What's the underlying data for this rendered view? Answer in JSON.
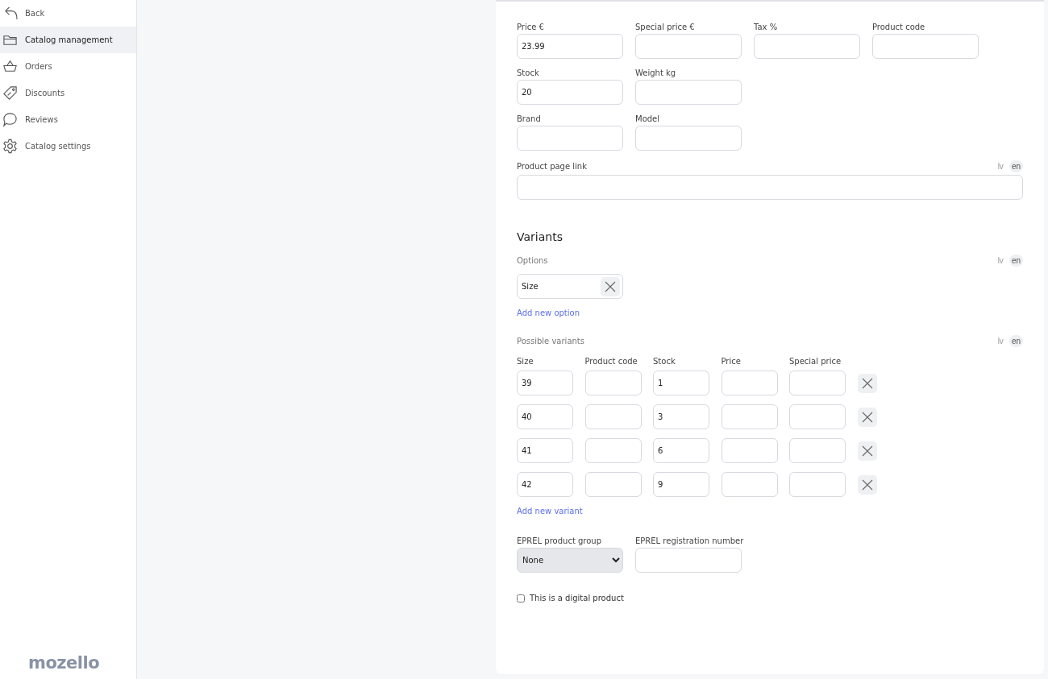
{
  "sidebar": {
    "items": [
      {
        "label": "Back",
        "kind": "back",
        "selected": false
      },
      {
        "label": "Catalog management",
        "kind": "folder",
        "selected": true
      },
      {
        "label": "Orders",
        "kind": "basket",
        "selected": false
      },
      {
        "label": "Discounts",
        "kind": "tag",
        "selected": false
      },
      {
        "label": "Reviews",
        "kind": "chat",
        "selected": false
      },
      {
        "label": "Catalog settings",
        "kind": "gear",
        "selected": false
      }
    ],
    "logo": "mozello"
  },
  "product_fields": [
    [
      {
        "label": "Price €",
        "value": "23.99"
      },
      {
        "label": "Special price €"
      },
      {
        "label": "Tax %"
      },
      {
        "label": "Product code"
      }
    ],
    [
      {
        "label": "Stock",
        "value": "20"
      },
      {
        "label": "Weight kg"
      }
    ],
    [
      {
        "label": "Brand"
      },
      {
        "label": "Model"
      }
    ]
  ],
  "product_page_link": {
    "label": "Product page link",
    "languages": [
      {
        "label": "lv",
        "selected": false
      },
      {
        "label": "en",
        "selected": true
      }
    ]
  },
  "variants": {
    "title": "Variants",
    "options": {
      "label": "Options",
      "languages": [
        {
          "label": "lv",
          "selected": false
        },
        {
          "label": "en",
          "selected": true
        }
      ],
      "items": [
        {
          "value": "Size"
        }
      ],
      "add_link": "Add new option"
    },
    "possible": {
      "label": "Possible variants",
      "languages": [
        {
          "label": "lv",
          "selected": false
        },
        {
          "label": "en",
          "selected": true
        }
      ],
      "columns": [
        "Size",
        "Product code",
        "Stock",
        "Price",
        "Special price"
      ],
      "rows": [
        {
          "cells": [
            "39",
            "",
            "1",
            "",
            ""
          ]
        },
        {
          "cells": [
            "40",
            "",
            "3",
            "",
            ""
          ]
        },
        {
          "cells": [
            "41",
            "",
            "6",
            "",
            ""
          ]
        },
        {
          "cells": [
            "42",
            "",
            "9",
            "",
            ""
          ]
        }
      ],
      "add_link": "Add new variant"
    }
  },
  "eprel": {
    "group": {
      "label": "EPREL product group",
      "value": "None"
    },
    "registration": {
      "label": "EPREL registration number"
    }
  },
  "digital": {
    "label": "This is a digital product",
    "checked": false
  }
}
